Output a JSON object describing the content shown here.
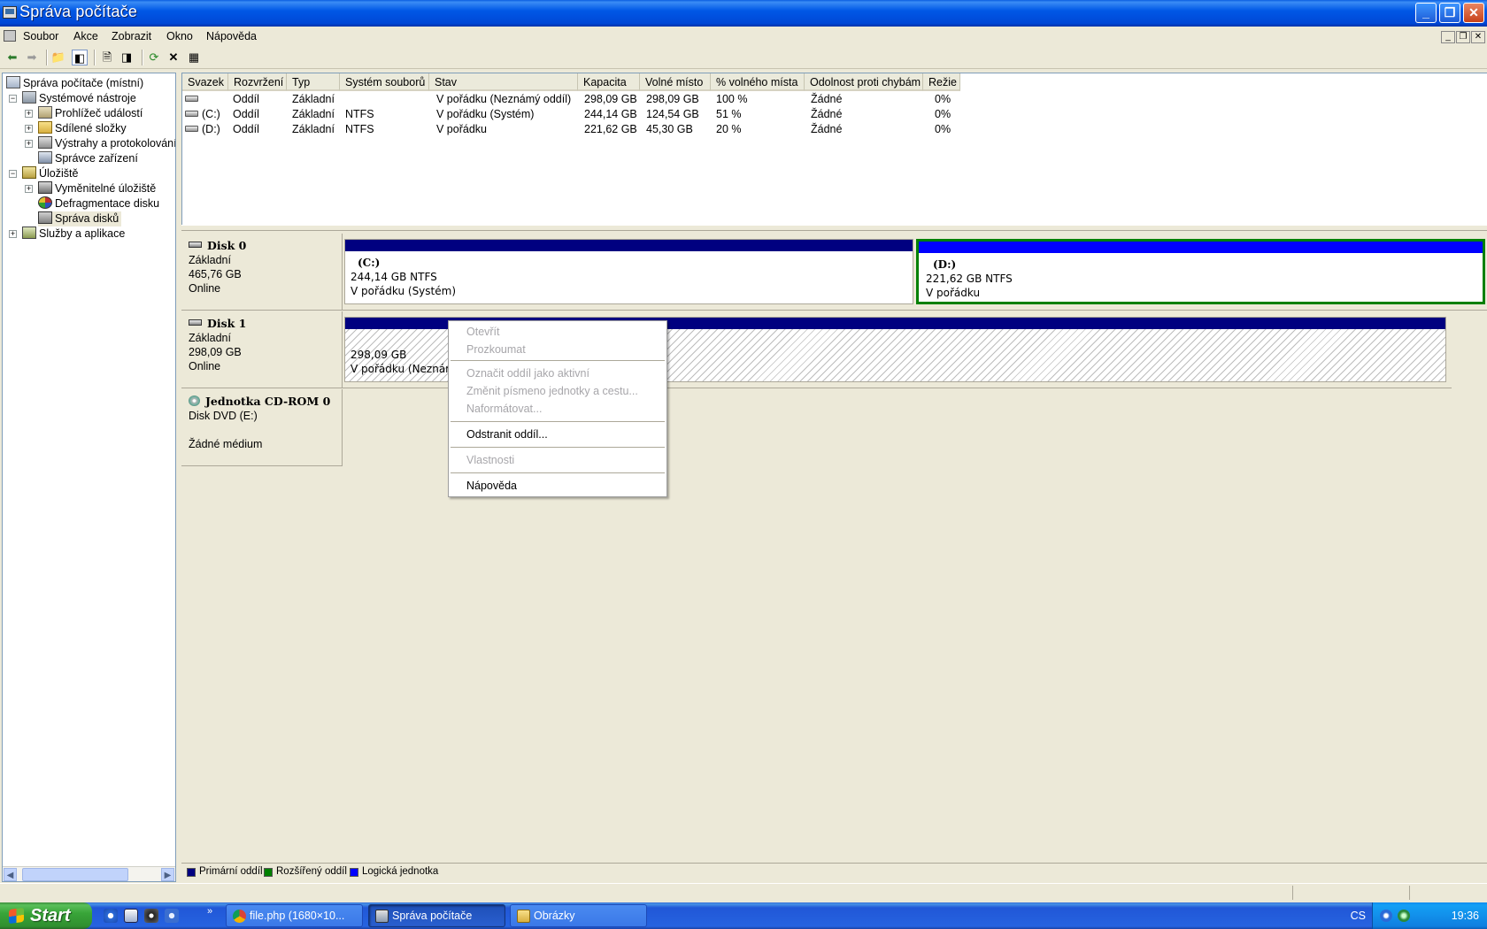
{
  "window": {
    "title": "Správa počítače"
  },
  "menu": [
    "Soubor",
    "Akce",
    "Zobrazit",
    "Okno",
    "Nápověda"
  ],
  "tree": {
    "items": [
      {
        "label": "Správa počítače (místní)",
        "icon": "computer-icon"
      },
      {
        "label": "Systémové nástroje",
        "icon": "tools-icon"
      },
      {
        "label": "Prohlížeč událostí",
        "icon": "event-viewer-icon"
      },
      {
        "label": "Sdílené složky",
        "icon": "shared-folders-icon"
      },
      {
        "label": "Výstrahy a protokolování výkonu",
        "icon": "alerts-icon"
      },
      {
        "label": "Správce zařízení",
        "icon": "device-manager-icon"
      },
      {
        "label": "Úložiště",
        "icon": "storage-icon"
      },
      {
        "label": "Vyměnitelné úložiště",
        "icon": "removable-storage-icon"
      },
      {
        "label": "Defragmentace disku",
        "icon": "defrag-icon"
      },
      {
        "label": "Správa disků",
        "icon": "disk-management-icon"
      },
      {
        "label": "Služby a aplikace",
        "icon": "services-icon"
      }
    ]
  },
  "volumes": {
    "columns": [
      "Svazek",
      "Rozvržení",
      "Typ",
      "Systém souborů",
      "Stav",
      "Kapacita",
      "Volné místo",
      "% volného místa",
      "Odolnost proti chybám",
      "Režie"
    ],
    "rows": [
      [
        "",
        "Oddíl",
        "Základní",
        "",
        "V pořádku (Neznámý oddíl)",
        "298,09 GB",
        "298,09 GB",
        "100 %",
        "Žádné",
        "0%"
      ],
      [
        "(C:)",
        "Oddíl",
        "Základní",
        "NTFS",
        "V pořádku (Systém)",
        "244,14 GB",
        "124,54 GB",
        "51 %",
        "Žádné",
        "0%"
      ],
      [
        "(D:)",
        "Oddíl",
        "Základní",
        "NTFS",
        "V pořádku",
        "221,62 GB",
        "45,30 GB",
        "20 %",
        "Žádné",
        "0%"
      ]
    ]
  },
  "disks": {
    "disk0": {
      "name": "Disk 0",
      "type": "Základní",
      "size": "465,76 GB",
      "status": "Online",
      "c": {
        "letter": "(C:)",
        "size": "244,14 GB NTFS",
        "status": "V pořádku (Systém)"
      },
      "d": {
        "letter": "(D:)",
        "size": "221,62 GB NTFS",
        "status": "V pořádku"
      }
    },
    "disk1": {
      "name": "Disk 1",
      "type": "Základní",
      "size": "298,09 GB",
      "status": "Online",
      "p": {
        "size": "298,09 GB",
        "status": "V pořádku (Neznámý oddíl)"
      }
    },
    "cdrom": {
      "name": "Jednotka CD-ROM 0",
      "type": "Disk DVD (E:)",
      "status": "Žádné médium"
    }
  },
  "context_menu": {
    "open": "Otevřít",
    "explore": "Prozkoumat",
    "mark_active": "Označit oddíl jako aktivní",
    "change_letter": "Změnit písmeno jednotky a cestu...",
    "format": "Naformátovat...",
    "delete": "Odstranit oddíl...",
    "properties": "Vlastnosti",
    "help": "Nápověda"
  },
  "legend": {
    "primary": "Primární oddíl",
    "extended": "Rozšířený oddíl",
    "logical": "Logická jednotka"
  },
  "colors": {
    "primary": "#000080",
    "extended": "#008000",
    "logical": "#0000FF"
  },
  "taskbar": {
    "start": "Start",
    "tasks": [
      "file.php (1680×10...",
      "Správa počítače",
      "Obrázky"
    ],
    "lang": "CS",
    "clock": "19:36"
  }
}
